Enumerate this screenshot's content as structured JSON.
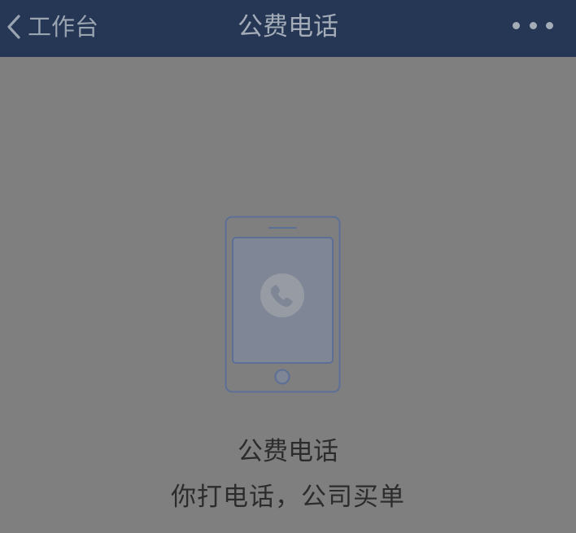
{
  "navbar": {
    "back_label": "工作台",
    "title": "公费电话",
    "more_icon": "more-dots-icon",
    "back_icon": "chevron-left-icon"
  },
  "main": {
    "illustration_icon": "phone-call-icon",
    "title": "公费电话",
    "subtitle": "你打电话，公司买单"
  },
  "colors": {
    "navbar_bg": "#253754",
    "page_bg": "#7f7f7f",
    "illustration_stroke": "#5c6f97",
    "text_dark": "#2c2c2c"
  }
}
